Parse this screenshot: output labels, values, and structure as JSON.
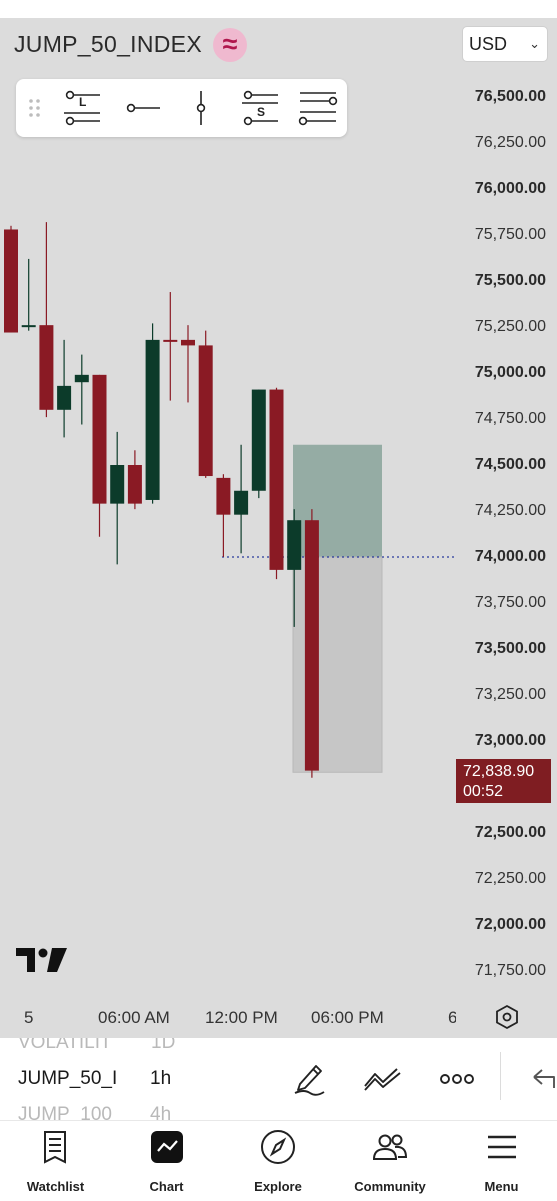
{
  "header": {
    "symbol": "JUMP_50_INDEX",
    "symbol_badge_glyph": "≈",
    "currency": "USD",
    "colors": {
      "badge_bg": "#efb9cf",
      "badge_fg": "#b0164d"
    }
  },
  "drawing_toolbar": {
    "tools": [
      {
        "name": "drag-handle-icon",
        "letter": ""
      },
      {
        "name": "long-position-tool",
        "letter": "L"
      },
      {
        "name": "horizontal-ray-tool",
        "letter": ""
      },
      {
        "name": "vertical-line-tool",
        "letter": ""
      },
      {
        "name": "short-position-tool",
        "letter": "S"
      },
      {
        "name": "parallel-channel-tool",
        "letter": ""
      }
    ]
  },
  "price_axis": {
    "labels": [
      {
        "text": "76,500.00",
        "bold": true
      },
      {
        "text": "76,250.00",
        "bold": false
      },
      {
        "text": "76,000.00",
        "bold": true
      },
      {
        "text": "75,750.00",
        "bold": false
      },
      {
        "text": "75,500.00",
        "bold": true
      },
      {
        "text": "75,250.00",
        "bold": false
      },
      {
        "text": "75,000.00",
        "bold": true
      },
      {
        "text": "74,750.00",
        "bold": false
      },
      {
        "text": "74,500.00",
        "bold": true
      },
      {
        "text": "74,250.00",
        "bold": false
      },
      {
        "text": "74,000.00",
        "bold": true
      },
      {
        "text": "73,750.00",
        "bold": false
      },
      {
        "text": "73,500.00",
        "bold": true
      },
      {
        "text": "73,250.00",
        "bold": false
      },
      {
        "text": "73,000.00",
        "bold": true
      },
      {
        "text": "72,500.00",
        "bold": true
      },
      {
        "text": "72,250.00",
        "bold": false
      },
      {
        "text": "72,000.00",
        "bold": true
      },
      {
        "text": "71,750.00",
        "bold": false
      }
    ],
    "current_price": "72,838.90",
    "countdown": "00:52"
  },
  "time_axis": {
    "labels": [
      "5",
      "06:00 AM",
      "12:00 PM",
      "06:00 PM",
      "6"
    ]
  },
  "chart_data": {
    "type": "candlestick",
    "symbol": "JUMP_50_INDEX",
    "interval": "1h",
    "colors": {
      "up": "#0c3b2a",
      "down": "#8a1a24",
      "background": "#dcdcdc",
      "last_price_line": "#2a3b9c"
    },
    "candles": [
      {
        "o": 75780,
        "h": 75800,
        "l": 75220,
        "c": 75220
      },
      {
        "o": 75250,
        "h": 75620,
        "l": 75230,
        "c": 75260
      },
      {
        "o": 75260,
        "h": 75820,
        "l": 74760,
        "c": 74800
      },
      {
        "o": 74800,
        "h": 75180,
        "l": 74650,
        "c": 74930
      },
      {
        "o": 74950,
        "h": 75100,
        "l": 74720,
        "c": 74990
      },
      {
        "o": 74990,
        "h": 74990,
        "l": 74110,
        "c": 74290
      },
      {
        "o": 74290,
        "h": 74680,
        "l": 73960,
        "c": 74500
      },
      {
        "o": 74500,
        "h": 74580,
        "l": 74260,
        "c": 74290
      },
      {
        "o": 74310,
        "h": 75270,
        "l": 74290,
        "c": 75180
      },
      {
        "o": 75180,
        "h": 75440,
        "l": 74850,
        "c": 75170
      },
      {
        "o": 75180,
        "h": 75260,
        "l": 74840,
        "c": 75150
      },
      {
        "o": 75150,
        "h": 75230,
        "l": 74430,
        "c": 74440
      },
      {
        "o": 74430,
        "h": 74450,
        "l": 74000,
        "c": 74230
      },
      {
        "o": 74230,
        "h": 74610,
        "l": 74020,
        "c": 74360
      },
      {
        "o": 74360,
        "h": 74910,
        "l": 74320,
        "c": 74910
      },
      {
        "o": 74910,
        "h": 74920,
        "l": 73880,
        "c": 73930
      },
      {
        "o": 73930,
        "h": 74260,
        "l": 73620,
        "c": 74200
      },
      {
        "o": 74200,
        "h": 74260,
        "l": 72800,
        "c": 72839
      }
    ],
    "last_price": 72838.9,
    "dotted_level": 74000,
    "long_position": {
      "entry": 74000,
      "target": 74610,
      "stop": 72830
    },
    "y_range": [
      71700,
      76700
    ]
  },
  "lower_panel": {
    "prev_symbol": "VOLATILIT",
    "prev_interval": "1D",
    "symbol": "JUMP_50_I",
    "interval": "1h",
    "next_symbol": "JUMP_100",
    "next_interval": "4h"
  },
  "bottom_nav": {
    "items": [
      {
        "name": "watchlist",
        "label": "Watchlist"
      },
      {
        "name": "chart",
        "label": "Chart"
      },
      {
        "name": "explore",
        "label": "Explore"
      },
      {
        "name": "community",
        "label": "Community"
      },
      {
        "name": "menu",
        "label": "Menu"
      }
    ]
  }
}
